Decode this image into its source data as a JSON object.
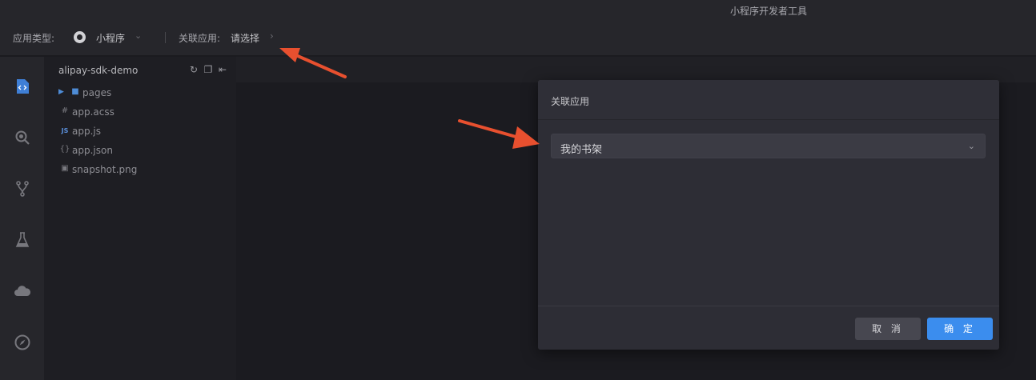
{
  "window": {
    "title": "小程序开发者工具"
  },
  "toolbar": {
    "app_type_label": "应用类型:",
    "app_type_value": "小程序",
    "related_app_label": "关联应用:",
    "related_app_value": "请选择"
  },
  "activity_bar": {
    "icons": [
      "code-file-icon",
      "search-debug-icon",
      "git-branch-icon",
      "flask-icon",
      "cloud-icon",
      "compass-icon"
    ]
  },
  "explorer": {
    "project_name": "alipay-sdk-demo",
    "actions": [
      "refresh-icon",
      "new-file-icon",
      "collapse-icon"
    ],
    "items": [
      {
        "label": "pages",
        "type": "folder"
      },
      {
        "label": "app.acss",
        "type": "acss"
      },
      {
        "label": "app.js",
        "type": "js"
      },
      {
        "label": "app.json",
        "type": "json"
      },
      {
        "label": "snapshot.png",
        "type": "image"
      }
    ]
  },
  "modal": {
    "title": "关联应用",
    "select_value": "我的书架",
    "cancel_label": "取 消",
    "ok_label": "确 定"
  },
  "colors": {
    "accent": "#3b8dee",
    "annotation_arrow": "#e8502f"
  }
}
